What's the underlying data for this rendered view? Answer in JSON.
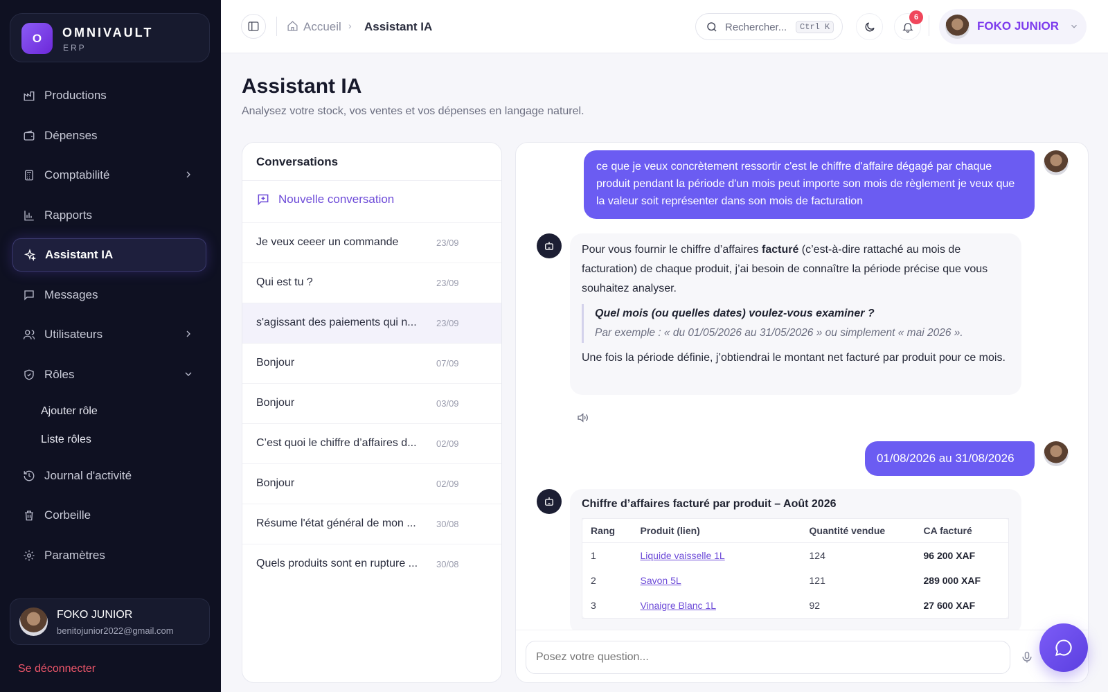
{
  "brand": {
    "logo_letter": "O",
    "name": "OMNIVAULT",
    "sub": "ERP"
  },
  "sidebar": {
    "items": [
      {
        "label": "Productions",
        "icon": "factory-icon"
      },
      {
        "label": "Dépenses",
        "icon": "wallet-icon"
      },
      {
        "label": "Comptabilité",
        "icon": "calculator-icon"
      },
      {
        "label": "Rapports",
        "icon": "bar-chart-icon"
      },
      {
        "label": "Assistant IA",
        "icon": "sparkles-icon"
      },
      {
        "label": "Messages",
        "icon": "message-icon"
      },
      {
        "label": "Utilisateurs",
        "icon": "users-icon"
      },
      {
        "label": "Rôles",
        "icon": "shield-icon"
      },
      {
        "label": "Journal d'activité",
        "icon": "history-icon"
      },
      {
        "label": "Corbeille",
        "icon": "trash-icon"
      },
      {
        "label": "Paramètres",
        "icon": "gear-icon"
      }
    ],
    "sub_items": [
      "Ajouter rôle",
      "Liste rôles"
    ],
    "user": {
      "name": "FOKO JUNIOR",
      "email": "benitojunior2022@gmail.com"
    },
    "logout": "Se déconnecter"
  },
  "topbar": {
    "breadcrumb_home": "Accueil",
    "breadcrumb_current": "Assistant IA",
    "search_placeholder": "Rechercher...",
    "search_shortcut": "Ctrl K",
    "notifications_count": "6",
    "profile_name": "FOKO JUNIOR"
  },
  "page": {
    "title": "Assistant IA",
    "subtitle": "Analysez votre stock, vos ventes et vos dépenses en langage naturel."
  },
  "conversations": {
    "title": "Conversations",
    "new_label": "Nouvelle conversation",
    "items": [
      {
        "text": "Je veux ceeer un commande",
        "date": "23/09"
      },
      {
        "text": "Qui est tu ?",
        "date": "23/09"
      },
      {
        "text": "s'agissant des paiements qui n...",
        "date": "23/09"
      },
      {
        "text": "Bonjour",
        "date": "07/09"
      },
      {
        "text": "Bonjour",
        "date": "03/09"
      },
      {
        "text": "C’est quoi le chiffre d’affaires d...",
        "date": "02/09"
      },
      {
        "text": "Bonjour",
        "date": "02/09"
      },
      {
        "text": "Résume l'état général de mon ...",
        "date": "30/08"
      },
      {
        "text": "Quels produits sont en rupture ...",
        "date": "30/08"
      }
    ]
  },
  "chat": {
    "msg1": "ce que je veux concrètement ressortir c'est le chiffre d'affaire dégagé par chaque produit pendant la période d'un mois peut importe son mois de règlement je veux que la valeur soit représenter dans son mois de facturation",
    "bot1_pre": "Pour vous fournir le chiffre d’affaires ",
    "bot1_bold": "facturé",
    "bot1_post": " (c’est-à-dire rattaché au mois de facturation) de chaque produit, j’ai besoin de connaître la période précise que vous souhaitez analyser.",
    "bot1_quote_q": "Quel mois (ou quelles dates) voulez-vous examiner ?",
    "bot1_quote_ex": "Par exemple : « du 01/05/2026 au 31/05/2026 » ou simplement « mai 2026 ».",
    "bot1_end": "Une fois la période définie, j’obtiendrai le montant net facturé par produit pour ce mois.",
    "msg2": "01/08/2026 au 31/08/2026",
    "bot2_title": "Chiffre d’affaires facturé par produit – Août 2026",
    "table_headers": [
      "Rang",
      "Produit (lien)",
      "Quantité vendue",
      "CA facturé"
    ],
    "table_rows": [
      [
        "1",
        "Liquide vaisselle 1L",
        "124",
        "96 200 XAF"
      ],
      [
        "2",
        "Savon 5L",
        "121",
        "289 000 XAF"
      ],
      [
        "3",
        "Vinaigre Blanc 1L",
        "92",
        "27 600 XAF"
      ]
    ],
    "input_placeholder": "Posez votre question..."
  },
  "colors": {
    "accent": "#6b5cf2",
    "sidebar_bg": "#0f1122",
    "danger": "#f0576b"
  }
}
